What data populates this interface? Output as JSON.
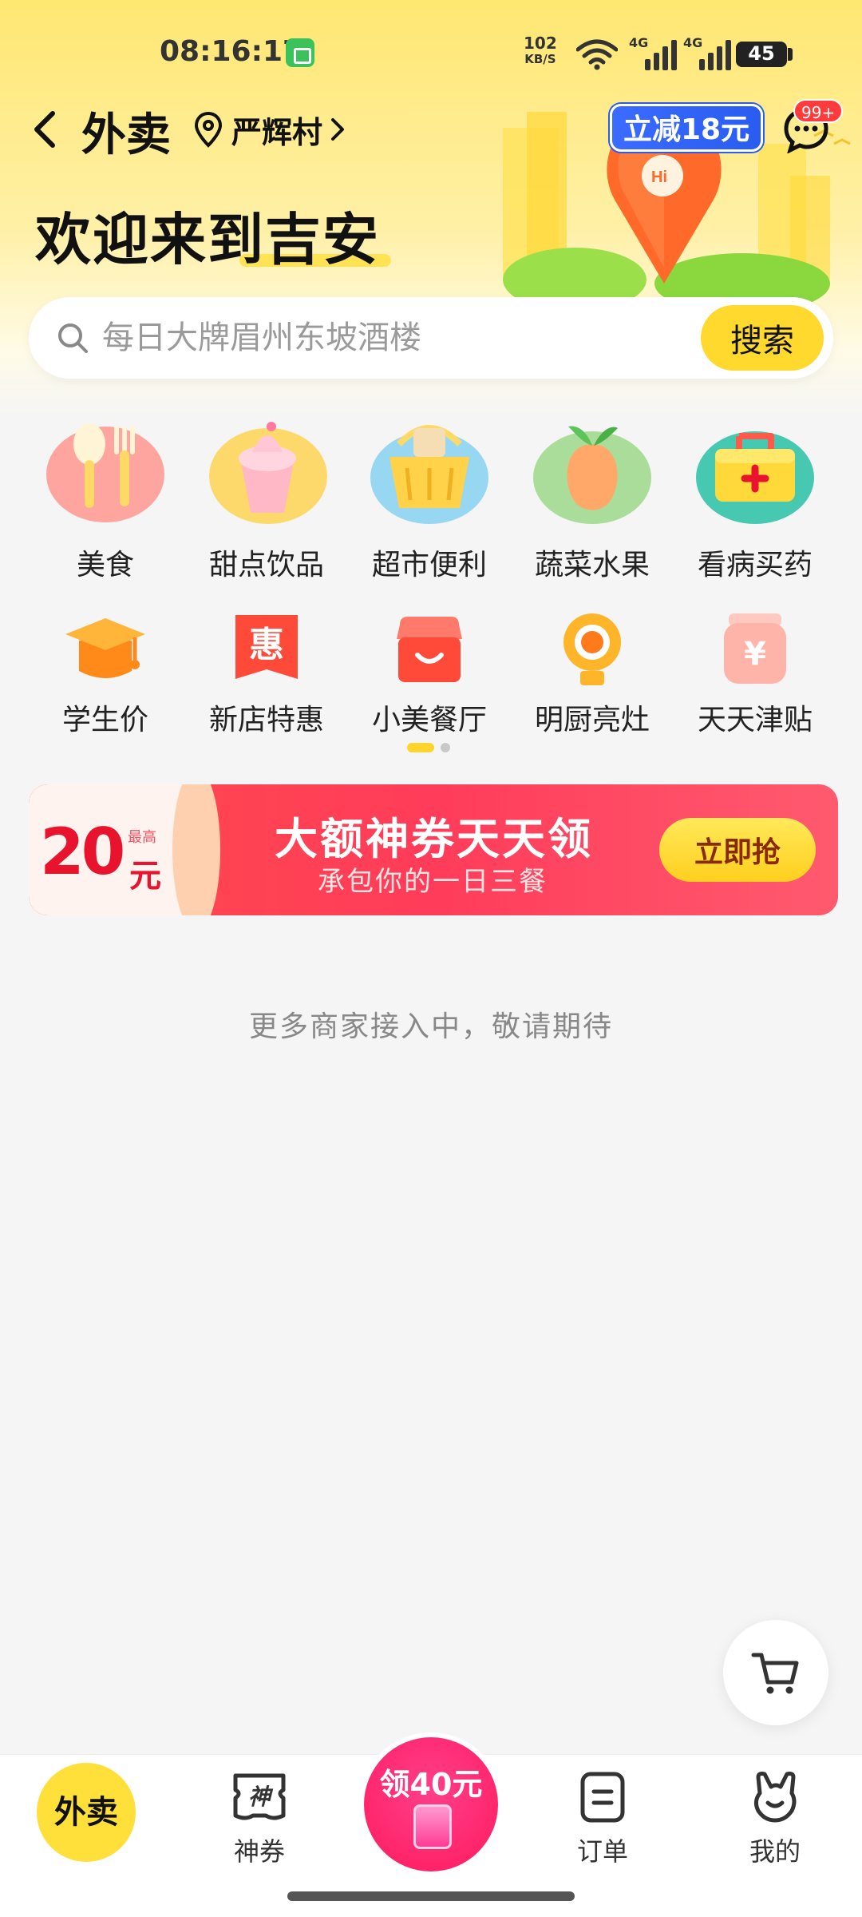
{
  "status_bar": {
    "time": "08:16:17",
    "speed_value": "102",
    "speed_unit": "KB/S",
    "network_1": "4G",
    "network_2": "4G",
    "battery": "45"
  },
  "header": {
    "title": "外卖",
    "location": "严辉村",
    "promo_badge": "立减18元",
    "message_badge": "99+",
    "welcome": "欢迎来到吉安"
  },
  "search": {
    "placeholder": "每日大牌眉州东坡酒楼",
    "button": "搜索"
  },
  "categories": {
    "row1": [
      {
        "label": "美食",
        "icon": "utensils-icon"
      },
      {
        "label": "甜点饮品",
        "icon": "ice-cream-icon"
      },
      {
        "label": "超市便利",
        "icon": "basket-icon"
      },
      {
        "label": "蔬菜水果",
        "icon": "fruit-icon"
      },
      {
        "label": "看病买药",
        "icon": "medicine-box-icon"
      }
    ],
    "row2": [
      {
        "label": "学生价",
        "icon": "graduation-cap-icon"
      },
      {
        "label": "新店特惠",
        "icon": "hui-tag-icon",
        "glyph": "惠"
      },
      {
        "label": "小美餐厅",
        "icon": "shop-icon"
      },
      {
        "label": "明厨亮灶",
        "icon": "camera-icon"
      },
      {
        "label": "天天津贴",
        "icon": "yuan-jar-icon",
        "glyph": "¥"
      }
    ],
    "pages": 2,
    "active_page": 1
  },
  "banner": {
    "amount": "20",
    "max_label": "最高",
    "unit": "元",
    "title": "大额神券天天领",
    "subtitle": "承包你的一日三餐",
    "button": "立即抢"
  },
  "empty_note": "更多商家接入中，敬请期待",
  "bottom_nav": {
    "home": "外卖",
    "coupons": "神券",
    "center": "领40元",
    "orders": "订单",
    "mine": "我的"
  },
  "colors": {
    "brand_yellow": "#ffd92e",
    "promo_blue": "#2a5cf0",
    "banner_red": "#ff3c5a",
    "center_pink": "#ff1a5e"
  }
}
